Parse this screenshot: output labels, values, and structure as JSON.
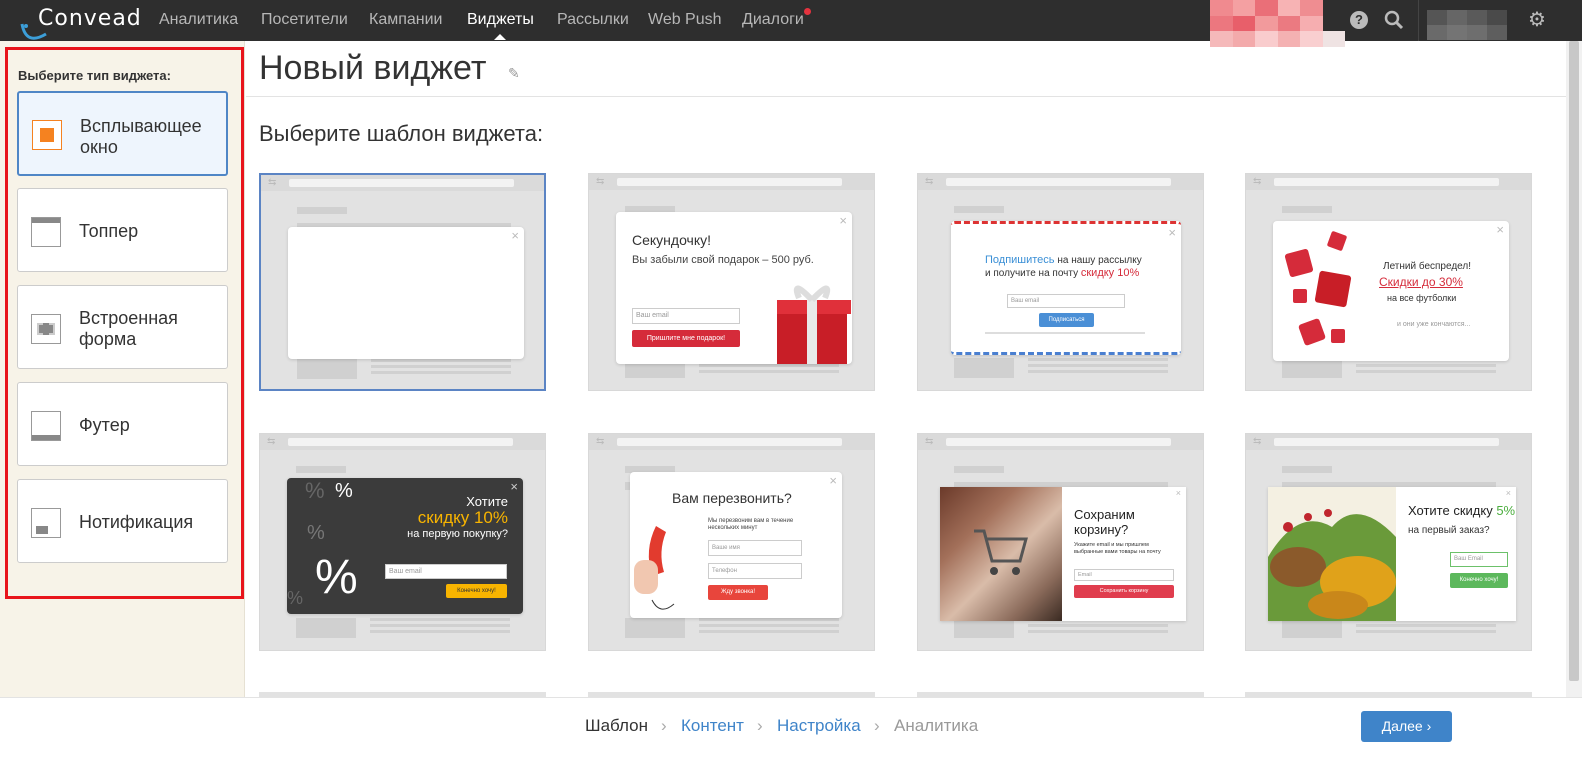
{
  "header": {
    "logo": "Convead",
    "nav": [
      "Аналитика",
      "Посетители",
      "Кампании",
      "Виджеты",
      "Рассылки",
      "Web Push",
      "Диалоги"
    ],
    "active": "Виджеты",
    "icons": [
      "help-icon",
      "search-icon",
      "gear-icon"
    ]
  },
  "sidebar": {
    "title": "Выберите тип виджета:",
    "types": [
      {
        "label": "Всплывающее окно",
        "icon": "popup-icon",
        "selected": true
      },
      {
        "label": "Топпер",
        "icon": "topper-icon"
      },
      {
        "label": "Встроенная форма",
        "icon": "embedded-form-icon"
      },
      {
        "label": "Футер",
        "icon": "footer-icon"
      },
      {
        "label": "Нотификация",
        "icon": "notification-icon"
      }
    ]
  },
  "main": {
    "title": "Новый виджет",
    "subtitle": "Выберите шаблон виджета:"
  },
  "templates": {
    "t2": {
      "title": "Секундочку!",
      "text": "Вы забыли свой подарок – 500 руб.",
      "placeholder": "Ваш email",
      "button": "Пришлите мне подарок!"
    },
    "t3": {
      "line1a": "Подпишитесь",
      "line1b": " на нашу рассылку",
      "line2a": "и получите на почту ",
      "line2b": "скидку 10%",
      "placeholder": "Ваш email",
      "button": "Подписаться"
    },
    "t4": {
      "line1": "Летний беспредел!",
      "line2": "Скидки до 30%",
      "line3": "на все футболки",
      "line4": "и они уже кончаются..."
    },
    "t5": {
      "line1": "Хотите",
      "line2": "скидку 10%",
      "line3": "на первую покупку?",
      "placeholder": "Ваш email",
      "button": "Конечно хочу!"
    },
    "t6": {
      "title": "Вам перезвонить?",
      "text": "Мы перезвоним вам в течение нескольких минут",
      "placeholder1": "Ваше имя",
      "placeholder2": "Телефон",
      "button": "Жду звонка!"
    },
    "t7": {
      "title": "Сохраним корзину?",
      "text": "Укажите email и мы пришлем выбранные вами товары на почту",
      "placeholder": "Email",
      "button": "Сохранить корзину"
    },
    "t8": {
      "title_a": "Хотите скидку ",
      "title_b": "5%",
      "line2": "на первый заказ?",
      "placeholder": "Ваш Email",
      "button": "Конечно хочу!"
    }
  },
  "footer": {
    "steps": [
      "Шаблон",
      "Контент",
      "Настройка",
      "Аналитика"
    ],
    "next": "Далее"
  },
  "colors": {
    "accent": "#3f84c9",
    "highlight": "#e8141b",
    "orange": "#f58220"
  }
}
